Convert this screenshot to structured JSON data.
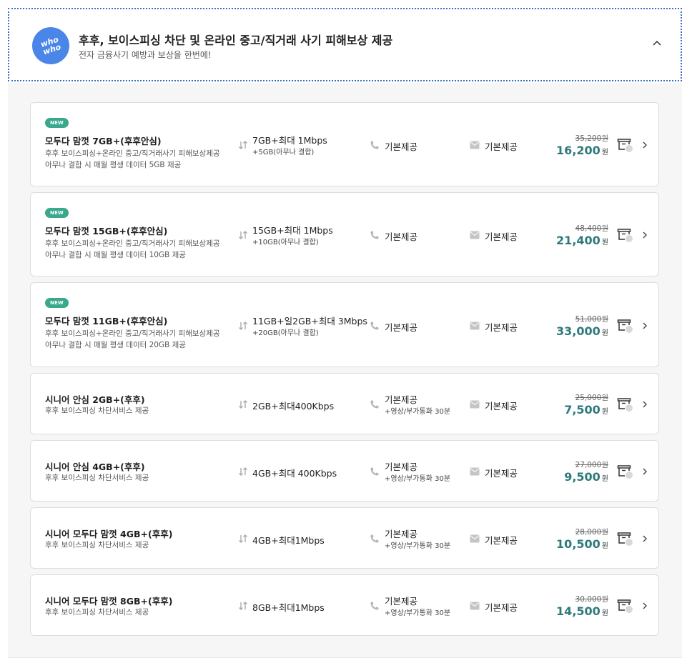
{
  "header": {
    "logo_text_top": "who",
    "logo_text_bottom": "who",
    "title": "후후, 보이스피싱 차단 및 온라인 중고/직거래 사기 피해보상 제공",
    "subtitle": "전자 금융사기 예방과 보상을 한번에!"
  },
  "colors": {
    "accent": "#2e7a7b",
    "badge": "#3aa88c",
    "brand_blue": "#4a86e8"
  },
  "icons": {
    "data": "data-arrows-icon",
    "call": "phone-icon",
    "message": "envelope-icon",
    "compare": "compare-box-icon",
    "chevron": "chevron-right-icon",
    "collapse": "chevron-up-icon"
  },
  "plans": [
    {
      "badge": "NEW",
      "name": "모두다 맘껏 7GB+(후후안심)",
      "desc1": "후후 보이스피싱+온라인 중고/직거래사기 피해보상제공",
      "desc2": "아무나 결합 시 매월 평생 데이터 5GB 제공",
      "data": "7GB+최대 1Mbps",
      "data_sub": "+5GB(아무나 결합)",
      "call": "기본제공",
      "call_sub": "",
      "message": "기본제공",
      "price_original": "35,200원",
      "price": "16,200",
      "price_unit": "원"
    },
    {
      "badge": "NEW",
      "name": "모두다 맘껏 15GB+(후후안심)",
      "desc1": "후후 보이스피싱+온라인 중고/직거래사기 피해보상제공",
      "desc2": "아무나 결합 시 매월 평생 데이터 10GB 제공",
      "data": "15GB+최대 1Mbps",
      "data_sub": "+10GB(아무나 결합)",
      "call": "기본제공",
      "call_sub": "",
      "message": "기본제공",
      "price_original": "48,400원",
      "price": "21,400",
      "price_unit": "원"
    },
    {
      "badge": "NEW",
      "name": "모두다 맘껏 11GB+(후후안심)",
      "desc1": "후후 보이스피싱+온라인 중고/직거래사기 피해보상제공",
      "desc2": "아무나 결합 시 매월 평생 데이터 20GB 제공",
      "data": "11GB+일2GB+최대 3Mbps",
      "data_sub": "+20GB(아무나 결합)",
      "call": "기본제공",
      "call_sub": "",
      "message": "기본제공",
      "price_original": "51,000원",
      "price": "33,000",
      "price_unit": "원"
    },
    {
      "badge": "",
      "name": "시니어 안심 2GB+(후후)",
      "desc1": "후후 보이스피싱 차단서비스 제공",
      "desc2": "",
      "data": "2GB+최대400Kbps",
      "data_sub": "",
      "call": "기본제공",
      "call_sub": "+영상/부가통화 30분",
      "message": "기본제공",
      "price_original": "25,000원",
      "price": "7,500",
      "price_unit": "원"
    },
    {
      "badge": "",
      "name": "시니어 안심 4GB+(후후)",
      "desc1": "후후 보이스피싱 차단서비스 제공",
      "desc2": "",
      "data": "4GB+최대 400Kbps",
      "data_sub": "",
      "call": "기본제공",
      "call_sub": "+영상/부가통화 30분",
      "message": "기본제공",
      "price_original": "27,000원",
      "price": "9,500",
      "price_unit": "원"
    },
    {
      "badge": "",
      "name": "시니어 모두다 맘껏 4GB+(후후)",
      "desc1": "후후 보이스피싱 차단서비스 제공",
      "desc2": "",
      "data": "4GB+최대1Mbps",
      "data_sub": "",
      "call": "기본제공",
      "call_sub": "+영상/부가통화 30분",
      "message": "기본제공",
      "price_original": "28,000원",
      "price": "10,500",
      "price_unit": "원"
    },
    {
      "badge": "",
      "name": "시니어 모두다 맘껏 8GB+(후후)",
      "desc1": "후후 보이스피싱 차단서비스 제공",
      "desc2": "",
      "data": "8GB+최대1Mbps",
      "data_sub": "",
      "call": "기본제공",
      "call_sub": "+영상/부가통화 30분",
      "message": "기본제공",
      "price_original": "30,000원",
      "price": "14,500",
      "price_unit": "원"
    }
  ]
}
